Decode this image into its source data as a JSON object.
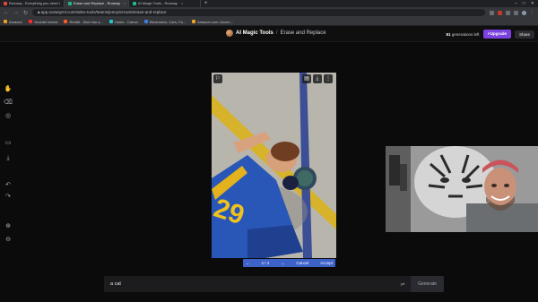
{
  "browser": {
    "tabs": [
      {
        "label": "Runway - Everything you need t",
        "active": false,
        "color": "#e8453c"
      },
      {
        "label": "Erase and Replace - Runway",
        "active": true,
        "color": "#1fb98a"
      },
      {
        "label": "AI Magic Tools - Runway",
        "active": false,
        "color": "#1fb98a"
      }
    ],
    "new_tab": "+",
    "window_controls": [
      "–",
      "□",
      "✕"
    ],
    "url": "app.runwayml.com/video-tools/teams/jenny/ai-tools/erase-and-replace",
    "bookmarks": [
      {
        "label": "Amazon",
        "color": "#f0a020"
      },
      {
        "label": "Youtube trends",
        "color": "#ff2a2a"
      },
      {
        "label": "Reddit - Dive into a...",
        "color": "#ff5a1f"
      },
      {
        "label": "Home - Canva",
        "color": "#20c4cc"
      },
      {
        "label": "Electronics, Cars, Fa...",
        "color": "#3b7fe0"
      },
      {
        "label": "Amazon.com: Accen...",
        "color": "#f0a020"
      }
    ]
  },
  "app": {
    "name": "AI Magic Tools",
    "separator": "/",
    "page": "Erase and Replace",
    "generations_count": "81",
    "generations_text": "generations left",
    "upgrade_label": "Upgrade",
    "share_label": "Share",
    "accent_color": "#7a43e0"
  },
  "toolbar": {
    "tools": [
      {
        "name": "hand-icon",
        "glyph": "✋"
      },
      {
        "name": "eraser-icon",
        "glyph": "⌫"
      },
      {
        "name": "target-icon",
        "glyph": "◎"
      },
      {
        "name": "folder-icon",
        "glyph": "▭"
      },
      {
        "name": "download-icon",
        "glyph": "⤓"
      },
      {
        "name": "undo-icon",
        "glyph": "↶"
      },
      {
        "name": "redo-icon",
        "glyph": "↷"
      },
      {
        "name": "zoom-in-icon",
        "glyph": "⊕"
      },
      {
        "name": "zoom-out-icon",
        "glyph": "⊖"
      }
    ]
  },
  "image_controls": {
    "counter": "4 / 4",
    "prev": "←",
    "next": "→",
    "cancel_label": "Cancel",
    "accept_label": "Accept",
    "bar_color": "#3d63c9"
  },
  "prompt": {
    "value": "a cat",
    "generate_label": "Generate"
  }
}
